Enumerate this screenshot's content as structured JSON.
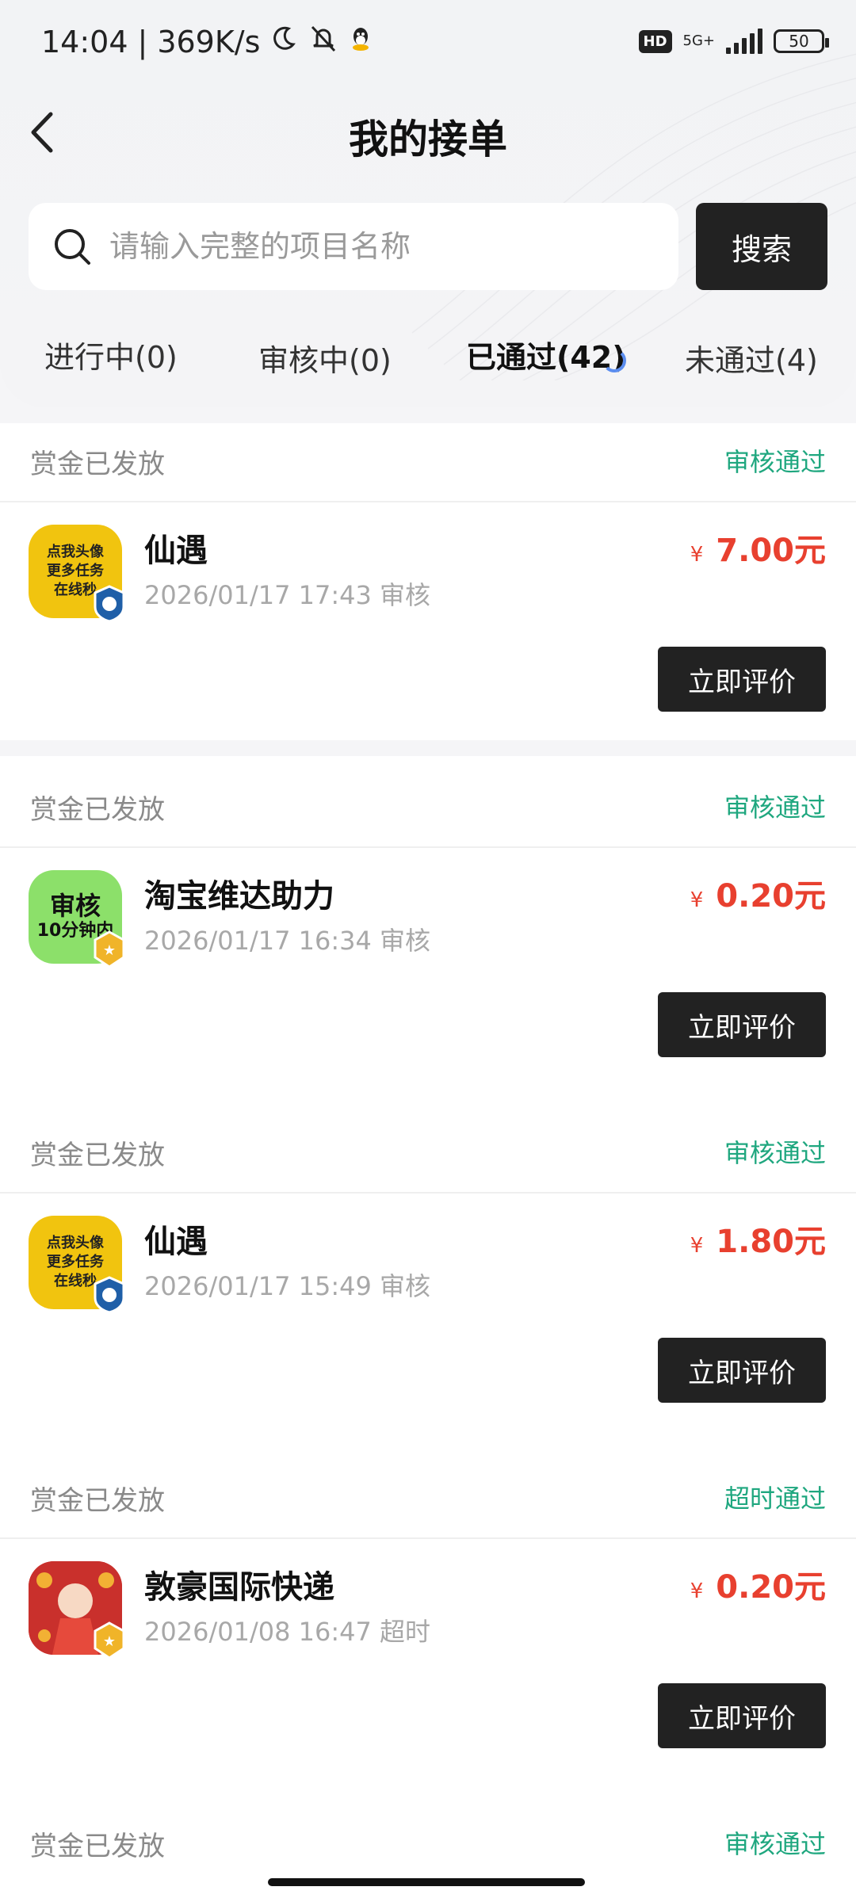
{
  "status_bar": {
    "time": "14:04",
    "speed": "369K/s",
    "hd": "HD",
    "network": "5G+",
    "battery": "50"
  },
  "nav": {
    "title": "我的接单"
  },
  "search": {
    "placeholder": "请输入完整的项目名称",
    "button": "搜索"
  },
  "tabs": [
    {
      "label": "进行中(0)"
    },
    {
      "label": "审核中(0)"
    },
    {
      "label": "已通过(42)"
    },
    {
      "label": "未通过(4)"
    }
  ],
  "active_tab": "已通过(42)",
  "cards": [
    {
      "reward_status": "赏金已发放",
      "review_status": "审核通过",
      "thumb_lines": [
        "点我头像",
        "更多任务",
        "在线秒"
      ],
      "name": "仙遇",
      "meta": "2026/01/17 17:43 审核",
      "currency": "¥",
      "amount": "7.00元",
      "button": "立即评价"
    },
    {
      "reward_status": "赏金已发放",
      "review_status": "审核通过",
      "thumb_lines": [
        "审核",
        "10分钟内"
      ],
      "name": "淘宝维达助力",
      "meta": "2026/01/17 16:34 审核",
      "currency": "¥",
      "amount": "0.20元",
      "button": "立即评价"
    },
    {
      "reward_status": "赏金已发放",
      "review_status": "审核通过",
      "thumb_lines": [
        "点我头像",
        "更多任务",
        "在线秒"
      ],
      "name": "仙遇",
      "meta": "2026/01/17 15:49 审核",
      "currency": "¥",
      "amount": "1.80元",
      "button": "立即评价"
    },
    {
      "reward_status": "赏金已发放",
      "review_status": "超时通过",
      "name": "敦豪国际快递",
      "meta": "2026/01/08 16:47 超时",
      "currency": "¥",
      "amount": "0.20元",
      "button": "立即评价"
    },
    {
      "reward_status": "赏金已发放",
      "review_status": "审核通过"
    }
  ],
  "colors": {
    "accent_green": "#1fa77f",
    "price_red": "#e8402f",
    "dark": "#222222"
  }
}
